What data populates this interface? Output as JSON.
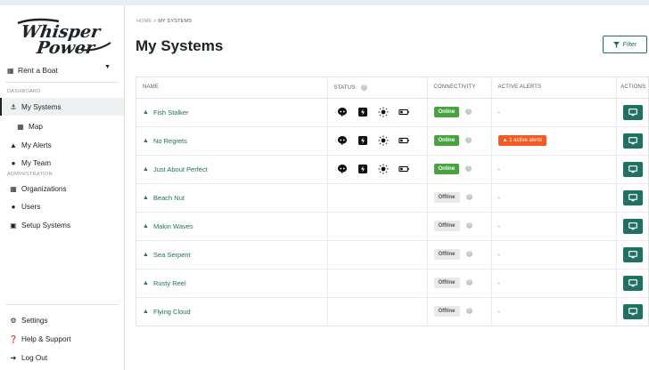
{
  "sidebar": {
    "boat_select": "Rent a Boat",
    "dashboard_heading": "DASHBOARD",
    "administration_heading": "ADMINISTRATION",
    "items": [
      {
        "label": "My Systems",
        "icon": "anchor-icon"
      },
      {
        "label": "Map",
        "icon": "map-icon"
      },
      {
        "label": "My Alerts",
        "icon": "bell-icon"
      },
      {
        "label": "My Team",
        "icon": "users-icon"
      },
      {
        "label": "Organizations",
        "icon": "building-icon"
      },
      {
        "label": "Users",
        "icon": "users-icon"
      },
      {
        "label": "Setup Systems",
        "icon": "ship-icon"
      }
    ],
    "bottom": [
      {
        "label": "Settings",
        "icon": "gear-icon"
      },
      {
        "label": "Help & Support",
        "icon": "question-icon"
      },
      {
        "label": "Log Out",
        "icon": "logout-icon"
      }
    ]
  },
  "breadcrumb": {
    "home": "HOME",
    "sep": " > ",
    "current": "MY SYSTEMS"
  },
  "page_title": "My Systems",
  "filter_label": "Filter",
  "table": {
    "headers": {
      "name": "NAME",
      "status": "STATUS",
      "connectivity": "CONNECTIVITY",
      "alerts": "ACTIVE ALERTS",
      "actions": "ACTIONS"
    },
    "rows": [
      {
        "name": "Fish Stalker",
        "online": true,
        "connectivity": "Online",
        "alert": "-"
      },
      {
        "name": "No Regrets",
        "online": true,
        "connectivity": "Online",
        "alert": "1 active alerts"
      },
      {
        "name": "Just About Perfect",
        "online": true,
        "connectivity": "Online",
        "alert": "-"
      },
      {
        "name": "Beach Nut",
        "online": false,
        "connectivity": "Offline",
        "alert": "-"
      },
      {
        "name": "Makin Waves",
        "online": false,
        "connectivity": "Offline",
        "alert": "-"
      },
      {
        "name": "Sea Serpent",
        "online": false,
        "connectivity": "Offline",
        "alert": "-"
      },
      {
        "name": "Rusty Reel",
        "online": false,
        "connectivity": "Offline",
        "alert": "-"
      },
      {
        "name": "Flying Cloud",
        "online": false,
        "connectivity": "Offline",
        "alert": "-"
      }
    ]
  },
  "logo": {
    "line1": "Whisper",
    "line2": "Power"
  },
  "colors": {
    "accent": "#1f6f63",
    "online": "#46a33d",
    "alert": "#f25c22",
    "background": "#e6eff1"
  }
}
